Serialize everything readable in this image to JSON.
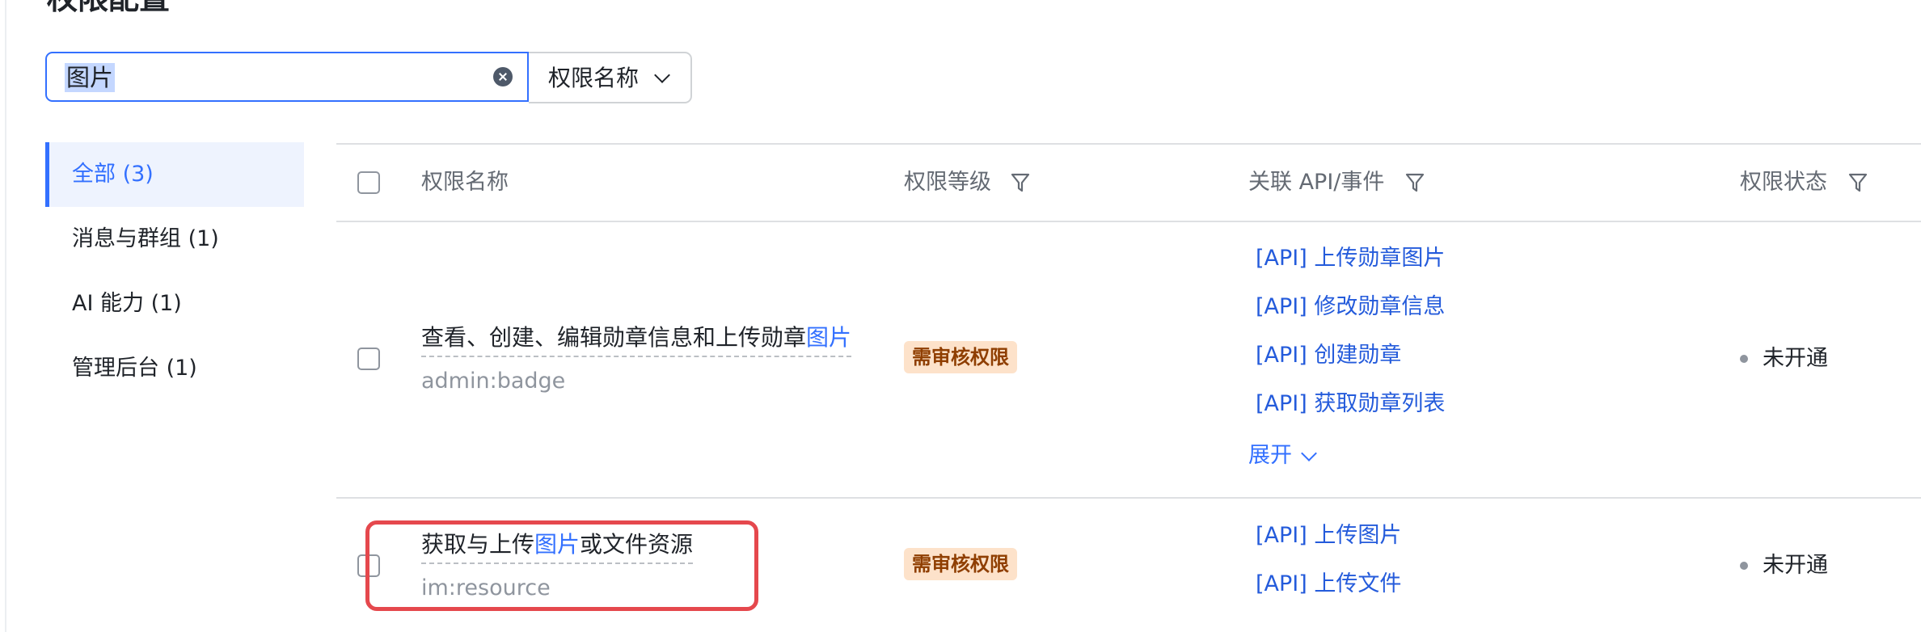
{
  "page": {
    "title": "权限配置"
  },
  "search": {
    "value": "图片",
    "field_select": "权限名称"
  },
  "sidebar": {
    "items": [
      {
        "label": "全部 (3)",
        "active": true
      },
      {
        "label": "消息与群组 (1)"
      },
      {
        "label": "AI 能力 (1)"
      },
      {
        "label": "管理后台 (1)"
      }
    ]
  },
  "table": {
    "columns": {
      "name": "权限名称",
      "level": "权限等级",
      "api": "关联 API/事件",
      "status": "权限状态"
    },
    "rows": [
      {
        "name_before": "查看、创建、编辑勋章信息和上传勋章",
        "name_highlight": "图片",
        "name_after": "",
        "code": "admin:badge",
        "level": "需审核权限",
        "apis": [
          "[API] 上传勋章图片",
          "[API] 修改勋章信息",
          "[API] 创建勋章",
          "[API] 获取勋章列表"
        ],
        "expand_label": "展开",
        "status": "未开通"
      },
      {
        "name_before": "获取与上传",
        "name_highlight": "图片",
        "name_after": "或文件资源",
        "code": "im:resource",
        "level": "需审核权限",
        "apis": [
          "[API] 上传图片",
          "[API] 上传文件"
        ],
        "status": "未开通"
      }
    ]
  },
  "colors": {
    "accent": "#3370ff",
    "badge_bg": "#fde2ca",
    "badge_text": "#8f3e00",
    "annotation": "#e5484d"
  }
}
